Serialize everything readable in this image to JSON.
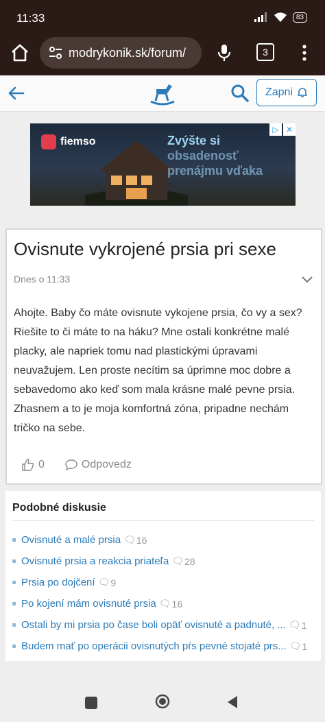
{
  "status": {
    "time": "11:33",
    "battery": "83"
  },
  "browser": {
    "url": "modrykonik.sk/forum/",
    "tab_count": "3"
  },
  "header": {
    "login_label": "Zapni"
  },
  "ad": {
    "brand": "fiemso",
    "line1": "Zvýšte si",
    "line2": "obsadenosť",
    "line3": "prenájmu vďaka"
  },
  "post": {
    "title": "Ovisnute vykrojené prsia pri sexe",
    "meta": "Dnes o 11:33",
    "body": "Ahojte. Baby čo máte ovisnute vykojene prsia, čo vy a sex? Riešite to či máte to na háku? Mne ostali konkrétne malé placky, ale napriek tomu nad plastickými úpravami neuvažujem. Len proste necítim sa úprimne moc dobre a sebavedomo ako keď som mala krásne malé pevne prsia. Zhasnem a to je moja komfortná zóna, pripadne nechám tričko na sebe.",
    "likes": "0",
    "reply_label": "Odpovedz"
  },
  "similar": {
    "title": "Podobné diskusie",
    "items": [
      {
        "label": "Ovisnuté a malé prsia",
        "count": "16"
      },
      {
        "label": "Ovisnuté prsia a reakcia priateľa",
        "count": "28"
      },
      {
        "label": "Prsia po dojčení",
        "count": "9"
      },
      {
        "label": "Po kojení mám ovisnuté prsia",
        "count": "16"
      },
      {
        "label": "Ostali by mi prsia po čase boli opäť ovisnuté a padnuté, ...",
        "count": "1"
      },
      {
        "label": "Budem mať po operácii ovisnutých pŕs pevné stojaté prs...",
        "count": "1"
      }
    ]
  }
}
